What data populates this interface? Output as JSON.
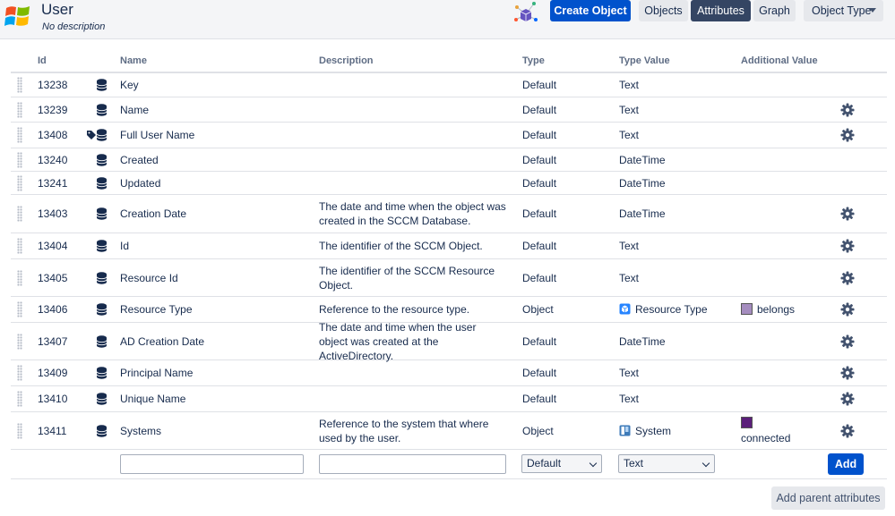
{
  "header": {
    "title": "User",
    "subtitle": "No description",
    "logo_icon": "windows-logo-icon",
    "graph_icon": "object-graph-icon"
  },
  "toolbar": {
    "create_label": "Create Object",
    "objects_label": "Objects",
    "attributes_label": "Attributes",
    "graph_label": "Graph",
    "object_type_label": "Object Type"
  },
  "columns": {
    "id": "Id",
    "name": "Name",
    "description": "Description",
    "type": "Type",
    "type_value": "Type Value",
    "additional_value": "Additional Value"
  },
  "rows": [
    {
      "id": "13238",
      "name": "Key",
      "description": "",
      "type": "Default",
      "type_value": "Text",
      "additional": "",
      "gear": false,
      "tag": false
    },
    {
      "id": "13239",
      "name": "Name",
      "description": "",
      "type": "Default",
      "type_value": "Text",
      "additional": "",
      "gear": true,
      "tag": false
    },
    {
      "id": "13408",
      "name": "Full User Name",
      "description": "",
      "type": "Default",
      "type_value": "Text",
      "additional": "",
      "gear": true,
      "tag": true
    },
    {
      "id": "13240",
      "name": "Created",
      "description": "",
      "type": "Default",
      "type_value": "DateTime",
      "additional": "",
      "gear": false,
      "tag": false
    },
    {
      "id": "13241",
      "name": "Updated",
      "description": "",
      "type": "Default",
      "type_value": "DateTime",
      "additional": "",
      "gear": false,
      "tag": false
    },
    {
      "id": "13403",
      "name": "Creation Date",
      "description": "The date and time when the object was created in the SCCM Database.",
      "type": "Default",
      "type_value": "DateTime",
      "additional": "",
      "gear": true,
      "tag": false
    },
    {
      "id": "13404",
      "name": "Id",
      "description": "The identifier of the SCCM Object.",
      "type": "Default",
      "type_value": "Text",
      "additional": "",
      "gear": true,
      "tag": false
    },
    {
      "id": "13405",
      "name": "Resource Id",
      "description": "The identifier of the SCCM Resource Object.",
      "type": "Default",
      "type_value": "Text",
      "additional": "",
      "gear": true,
      "tag": false
    },
    {
      "id": "13406",
      "name": "Resource Type",
      "description": "Reference to the resource type.",
      "type": "Object",
      "type_value": "Resource Type",
      "type_value_icon": "cube-icon",
      "additional": "belongs",
      "additional_color": "#a58dbf",
      "gear": true,
      "tag": false
    },
    {
      "id": "13407",
      "name": "AD Creation Date",
      "description": "The date and time when the user object was created at the ActiveDirectory.",
      "type": "Default",
      "type_value": "DateTime",
      "additional": "",
      "gear": true,
      "tag": false
    },
    {
      "id": "13409",
      "name": "Principal Name",
      "description": "",
      "type": "Default",
      "type_value": "Text",
      "additional": "",
      "gear": true,
      "tag": false
    },
    {
      "id": "13410",
      "name": "Unique Name",
      "description": "",
      "type": "Default",
      "type_value": "Text",
      "additional": "",
      "gear": true,
      "tag": false
    },
    {
      "id": "13411",
      "name": "Systems",
      "description": "Reference to the system that where used by the user.",
      "type": "Object",
      "type_value": "System",
      "type_value_icon": "computer-icon",
      "additional": "connected",
      "additional_color": "#5b1f7a",
      "gear": true,
      "tag": false
    }
  ],
  "new_row": {
    "name_value": "",
    "description_value": "",
    "type_selected": "Default",
    "type_value_selected": "Text",
    "add_label": "Add"
  },
  "footer": {
    "add_parent_label": "Add parent attributes"
  },
  "colors": {
    "primary": "#0052cc",
    "active_tab": "#344563"
  }
}
